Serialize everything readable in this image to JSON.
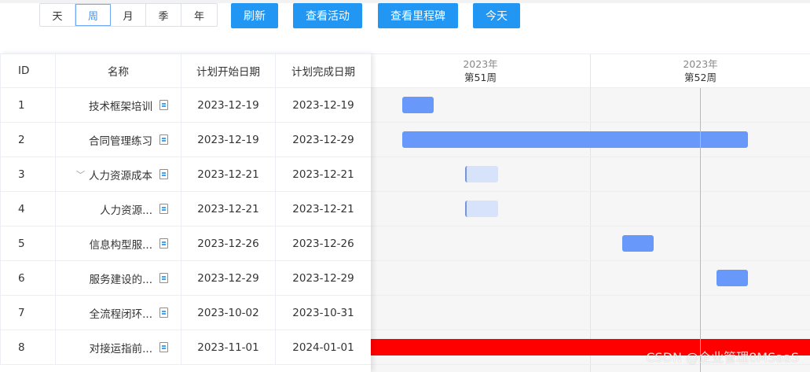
{
  "toolbar": {
    "scale_options": [
      "天",
      "周",
      "月",
      "季",
      "年"
    ],
    "active_scale": "周",
    "refresh": "刷新",
    "view_activity": "查看活动",
    "view_milestone": "查看里程碑",
    "today": "今天"
  },
  "columns": {
    "id": "ID",
    "name": "名称",
    "start": "计划开始日期",
    "end": "计划完成日期"
  },
  "timeline": {
    "weeks": [
      {
        "year": "2023年",
        "week": "第51周"
      },
      {
        "year": "2023年",
        "week": "第52周"
      }
    ],
    "today_marker": "2023-12-28"
  },
  "rows": [
    {
      "id": "1",
      "name": "技术框架培训",
      "start": "2023-12-19",
      "end": "2023-12-19",
      "bar_style": "normal"
    },
    {
      "id": "2",
      "name": "合同管理练习",
      "start": "2023-12-19",
      "end": "2023-12-29",
      "bar_style": "normal"
    },
    {
      "id": "3",
      "name": "人力资源成本",
      "start": "2023-12-21",
      "end": "2023-12-21",
      "bar_style": "light",
      "expandable": true
    },
    {
      "id": "4",
      "name": "人力资源...",
      "start": "2023-12-21",
      "end": "2023-12-21",
      "bar_style": "light"
    },
    {
      "id": "5",
      "name": "信息构型服...",
      "start": "2023-12-26",
      "end": "2023-12-26",
      "bar_style": "normal"
    },
    {
      "id": "6",
      "name": "服务建设的...",
      "start": "2023-12-29",
      "end": "2023-12-29",
      "bar_style": "normal"
    },
    {
      "id": "7",
      "name": "全流程闭环...",
      "start": "2023-10-02",
      "end": "2023-10-31",
      "bar_style": "none"
    },
    {
      "id": "8",
      "name": "对接运指前...",
      "start": "2023-11-01",
      "end": "2024-01-01",
      "bar_style": "overdue"
    }
  ],
  "colors": {
    "primary": "#2196f3",
    "bar": "#6898f9",
    "bar_light": "#d6e3fb",
    "overdue": "#ff0000",
    "today_line": "#f4a67c"
  },
  "watermark": "CSDN @企业管理8MSaaS"
}
